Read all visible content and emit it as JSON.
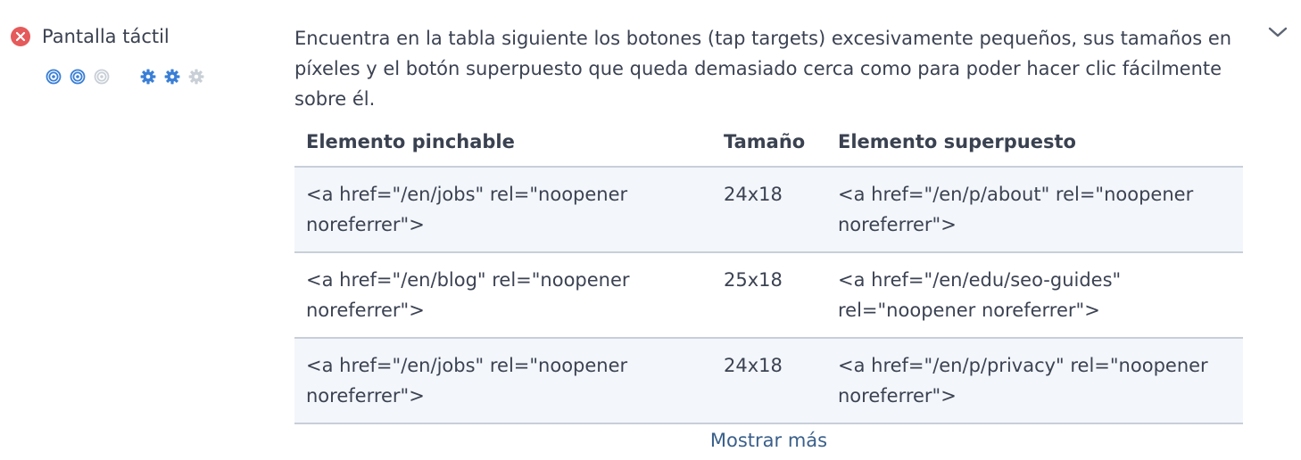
{
  "check": {
    "title": "Pantalla táctil",
    "status_icon": "error-x-icon",
    "status_color": "#e55a5a",
    "importance": {
      "value": 2,
      "max": 3,
      "icon": "target-icon",
      "active_color": "#3a7fd6",
      "inactive_color": "#c9cfd7"
    },
    "difficulty": {
      "value": 2,
      "max": 3,
      "icon": "gear-icon",
      "active_color": "#3a7fd6",
      "inactive_color": "#c9cfd7"
    }
  },
  "description": "Encuentra en la tabla siguiente los botones (tap targets) excesivamente pequeños, sus tamaños en píxeles y el botón superpuesto que queda demasiado cerca como para poder hacer clic fácilmente sobre él.",
  "table": {
    "headers": [
      "Elemento pinchable",
      "Tamaño",
      "Elemento superpuesto"
    ],
    "rows": [
      [
        "<a href=\"/en/jobs\" rel=\"noopener noreferrer\">",
        "24x18",
        "<a href=\"/en/p/about\" rel=\"noopener noreferrer\">"
      ],
      [
        "<a href=\"/en/blog\" rel=\"noopener noreferrer\">",
        "25x18",
        "<a href=\"/en/edu/seo-guides\" rel=\"noopener noreferrer\">"
      ],
      [
        "<a href=\"/en/jobs\" rel=\"noopener noreferrer\">",
        "24x18",
        "<a href=\"/en/p/privacy\" rel=\"noopener noreferrer\">"
      ]
    ]
  },
  "show_more_label": "Mostrar más",
  "expand_icon": "chevron-down-icon"
}
